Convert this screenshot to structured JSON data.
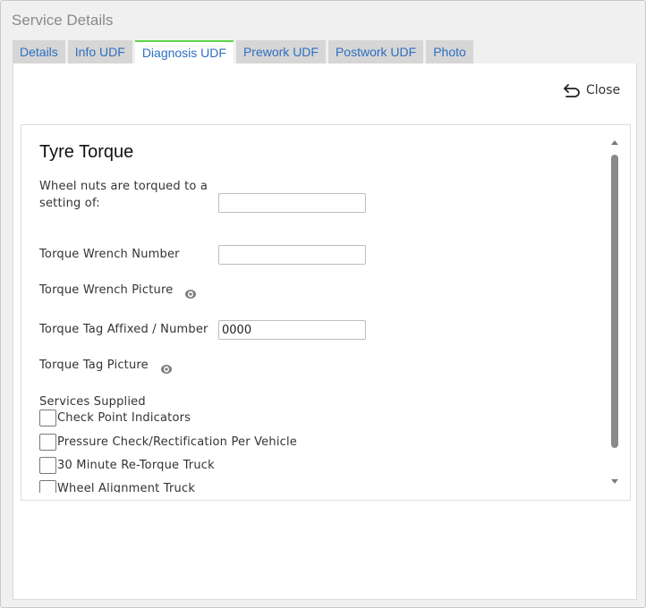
{
  "dialog": {
    "title": "Service Details"
  },
  "tabs": [
    {
      "label": "Details",
      "active": false
    },
    {
      "label": "Info UDF",
      "active": false
    },
    {
      "label": "Diagnosis UDF",
      "active": true
    },
    {
      "label": "Prework UDF",
      "active": false
    },
    {
      "label": "Postwork UDF",
      "active": false
    },
    {
      "label": "Photo",
      "active": false
    }
  ],
  "toolbar": {
    "close_label": "Close",
    "close_icon": "undo-arrow-icon"
  },
  "form": {
    "section_title": "Tyre Torque",
    "fields": {
      "wheel_nuts": {
        "label_line1": "Wheel nuts are torqued to a",
        "label_line2": "setting of:",
        "value": ""
      },
      "wrench_number": {
        "label": "Torque Wrench Number",
        "value": ""
      },
      "wrench_picture": {
        "label": "Torque Wrench Picture",
        "icon": "eye-icon"
      },
      "tag_number": {
        "label": "Torque Tag Affixed / Number",
        "value": "0000"
      },
      "tag_picture": {
        "label": "Torque Tag Picture",
        "icon": "eye-icon"
      }
    },
    "services": {
      "label": "Services Supplied",
      "items": [
        {
          "label": "Check Point Indicators",
          "checked": false
        },
        {
          "label": "Pressure Check/Rectification Per Vehicle",
          "checked": false
        },
        {
          "label": "30 Minute Re-Torque Truck",
          "checked": false
        },
        {
          "label": "Wheel Alignment Truck",
          "checked": false
        }
      ]
    }
  },
  "colors": {
    "tab_text": "#2d6fc0",
    "active_tab_indicator": "#5fd44a",
    "tab_background": "#d6d6d6"
  }
}
